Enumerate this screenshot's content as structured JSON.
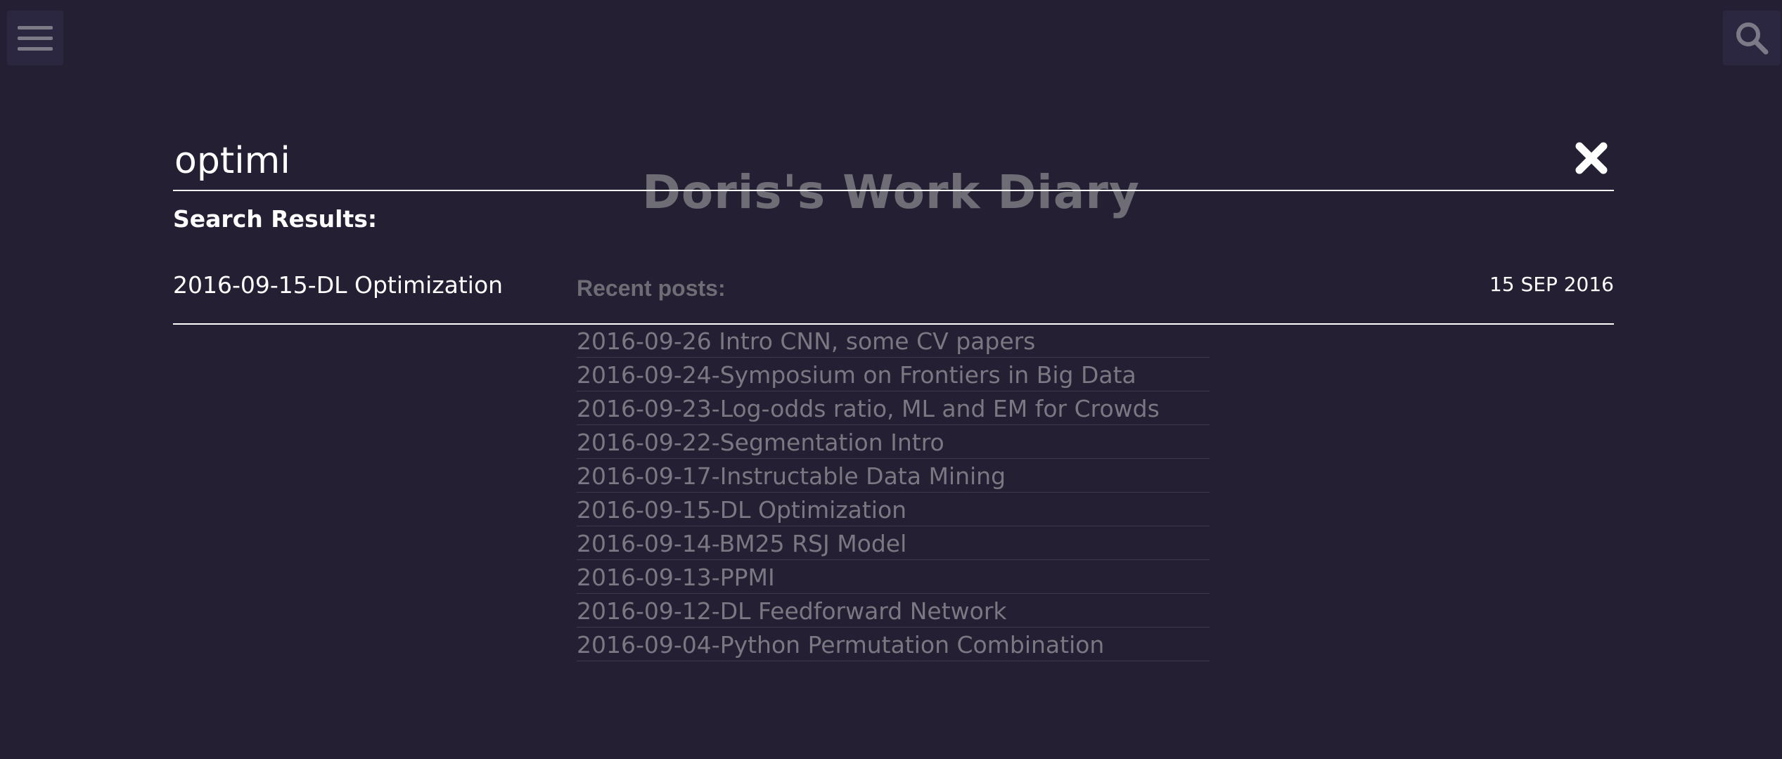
{
  "site": {
    "title": "Doris's Work Diary"
  },
  "icons": {
    "menu": "hamburger-menu-icon",
    "search": "search-icon",
    "close": "close-icon"
  },
  "colors": {
    "background": "#241f32",
    "text_active": "#ffffff",
    "text_dimmed": "#7a7882"
  },
  "search": {
    "value": "optimi",
    "results_heading": "Search Results:",
    "results": [
      {
        "title": "2016-09-15-DL Optimization",
        "date": "15 SEP 2016"
      }
    ]
  },
  "recent_posts": {
    "heading": "Recent posts:",
    "items": [
      "2016-09-26 Intro CNN, some CV papers",
      "2016-09-24-Symposium on Frontiers in Big Data",
      "2016-09-23-Log-odds ratio, ML and EM for Crowds",
      "2016-09-22-Segmentation Intro",
      "2016-09-17-Instructable Data Mining",
      "2016-09-15-DL Optimization",
      "2016-09-14-BM25 RSJ Model",
      "2016-09-13-PPMI",
      "2016-09-12-DL Feedforward Network",
      "2016-09-04-Python Permutation Combination"
    ]
  }
}
